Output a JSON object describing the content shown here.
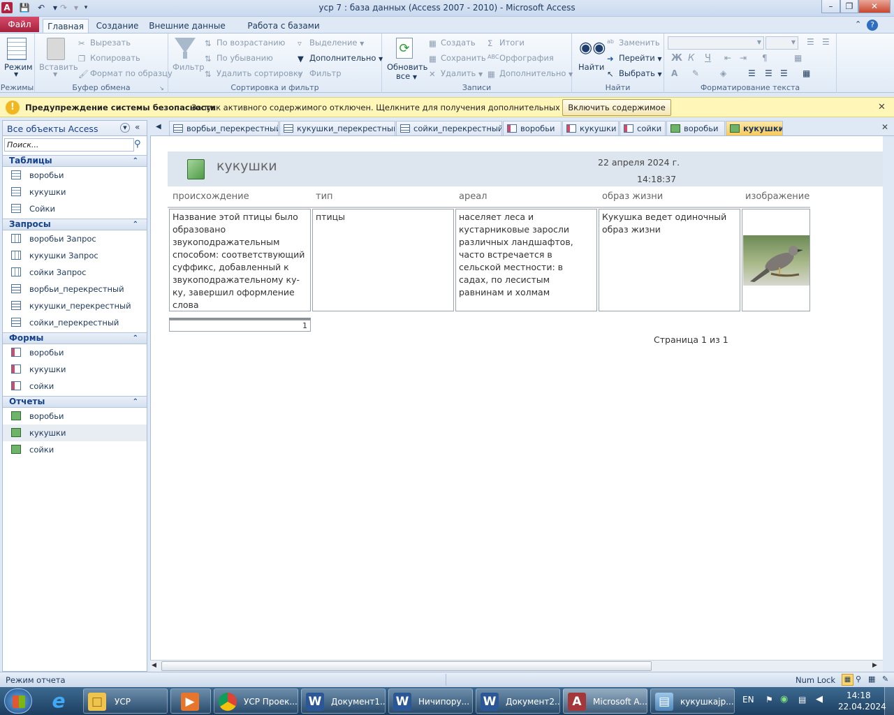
{
  "window": {
    "title": "уср 7 : база данных (Access 2007 - 2010)  -  Microsoft Access",
    "app_icon": "A"
  },
  "ribbon_tabs": [
    "Файл",
    "Главная",
    "Создание",
    "Внешние данные",
    "Работа с базами данных"
  ],
  "ribbon": {
    "views": {
      "label": "Режим",
      "group": "Режимы"
    },
    "clipboard": {
      "paste": "Вставить",
      "cut": "Вырезать",
      "copy": "Копировать",
      "format_painter": "Формат по образцу",
      "group": "Буфер обмена"
    },
    "sort_filter": {
      "filter": "Фильтр",
      "ascending": "По возрастанию",
      "descending": "По убыванию",
      "remove_sort": "Удалить сортировку",
      "selection": "Выделение",
      "advanced": "Дополнительно",
      "toggle_filter": "Фильтр",
      "group": "Сортировка и фильтр"
    },
    "records": {
      "refresh": "Обновить",
      "refresh2": "все",
      "new": "Создать",
      "save": "Сохранить",
      "delete": "Удалить",
      "totals": "Итоги",
      "spelling": "Орфография",
      "more": "Дополнительно",
      "group": "Записи"
    },
    "find": {
      "find": "Найти",
      "replace": "Заменить",
      "goto": "Перейти",
      "select": "Выбрать",
      "group": "Найти"
    },
    "text_format": {
      "bold": "Ж",
      "italic": "К",
      "underline": "Ч",
      "group": "Форматирование текста"
    }
  },
  "warning": {
    "title": "Предупреждение системы безопасности",
    "message": "Запуск активного содержимого отключен. Щелкните для получения дополнительных сведений.",
    "button": "Включить содержимое"
  },
  "nav": {
    "header": "Все объекты Access",
    "search_placeholder": "Поиск...",
    "sections": [
      {
        "title": "Таблицы",
        "items": [
          "воробьи",
          "кукушки",
          "Сойки"
        ]
      },
      {
        "title": "Запросы",
        "items": [
          "воробьи Запрос",
          "кукушки Запрос",
          "сойки Запрос",
          "ворбьи_перекрестный",
          "кукушки_перекрестный",
          "сойки_перекрестный"
        ]
      },
      {
        "title": "Формы",
        "items": [
          "воробьи",
          "кукушки",
          "сойки"
        ]
      },
      {
        "title": "Отчеты",
        "items": [
          "воробьи",
          "кукушки",
          "сойки"
        ]
      }
    ]
  },
  "doc_tabs": [
    "ворбьи_перекрестный",
    "кукушки_перекрестный",
    "сойки_перекрестный",
    "воробьи",
    "кукушки",
    "сойки",
    "воробьи",
    "кукушки"
  ],
  "report": {
    "title": "кукушки",
    "date": "22 апреля 2024 г.",
    "time": "14:18:37",
    "columns": [
      "происхождение",
      "тип",
      "ареал",
      "образ жизни",
      "изображение"
    ],
    "row": {
      "origin": "Название этой птицы было образовано звукоподражательным способом: соответствующий суффикс, добавленный к звукоподражательному ку-ку, завершил оформление слова",
      "type": "птицы",
      "range": "населяет леса и кустарниковые заросли различных ландшафтов, часто встречается в сельской местности: в садах, по лесистым равнинам и холмам",
      "lifestyle": "Кукушка ведет одиночный образ жизни"
    },
    "count": "1",
    "page": "Страница 1 из 1"
  },
  "status": {
    "left": "Режим отчета",
    "numlock": "Num Lock"
  },
  "taskbar": {
    "items": [
      "УСР",
      "УСР Проек...",
      "Документ1...",
      "Ничипору...",
      "Документ2...",
      "Microsoft A...",
      "кукушкајр..."
    ],
    "lang": "EN",
    "time": "14:18",
    "date": "22.04.2024"
  }
}
